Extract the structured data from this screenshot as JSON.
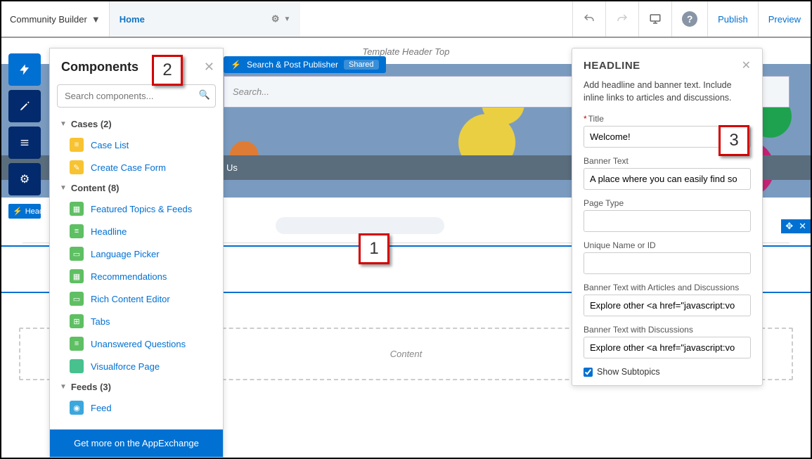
{
  "topbar": {
    "app_name": "Community Builder",
    "page": "Home",
    "publish": "Publish",
    "preview": "Preview"
  },
  "rail": {
    "selected_component": "Headli"
  },
  "components": {
    "title": "Components",
    "search_placeholder": "Search components...",
    "footer": "Get more on the AppExchange",
    "groups": [
      {
        "label": "Cases (2)",
        "items": [
          {
            "label": "Case List",
            "color": "#f8c332",
            "glyph": "≡"
          },
          {
            "label": "Create Case Form",
            "color": "#f8c332",
            "glyph": "✎"
          }
        ]
      },
      {
        "label": "Content (8)",
        "items": [
          {
            "label": "Featured Topics & Feeds",
            "color": "#5fbf63",
            "glyph": "▦"
          },
          {
            "label": "Headline",
            "color": "#5fbf63",
            "glyph": "≡"
          },
          {
            "label": "Language Picker",
            "color": "#5fbf63",
            "glyph": "▭"
          },
          {
            "label": "Recommendations",
            "color": "#5fbf63",
            "glyph": "▦"
          },
          {
            "label": "Rich Content Editor",
            "color": "#5fbf63",
            "glyph": "▭"
          },
          {
            "label": "Tabs",
            "color": "#5fbf63",
            "glyph": "⊞"
          },
          {
            "label": "Unanswered Questions",
            "color": "#5fbf63",
            "glyph": "≡"
          },
          {
            "label": "Visualforce Page",
            "color": "#47c18e",
            "glyph": "</>"
          }
        ]
      },
      {
        "label": "Feeds (3)",
        "items": [
          {
            "label": "Feed",
            "color": "#3ba7dd",
            "glyph": "◉"
          }
        ]
      }
    ]
  },
  "page": {
    "region_top": "Template Header Top",
    "search_publisher": "Search & Post Publisher",
    "shared_badge": "Shared",
    "search_placeholder": "Search...",
    "subheader": "Us",
    "region_content": "Content"
  },
  "properties": {
    "heading": "HEADLINE",
    "description": "Add headline and banner text. Include inline links to articles and discussions.",
    "fields": {
      "title_label": "Title",
      "title_value": "Welcome!",
      "banner_label": "Banner Text",
      "banner_value": "A place where you can easily find so",
      "pagetype_label": "Page Type",
      "pagetype_value": "",
      "unique_label": "Unique Name or ID",
      "unique_value": "",
      "banner_art_label": "Banner Text with Articles and Discussions",
      "banner_art_value": "Explore other <a href=\"javascript:vo",
      "banner_disc_label": "Banner Text with Discussions",
      "banner_disc_value": "Explore other <a href=\"javascript:vo",
      "subtopics_label": "Show Subtopics",
      "subtopics_checked": true
    }
  },
  "callouts": {
    "one": "1",
    "two": "2",
    "three": "3"
  }
}
